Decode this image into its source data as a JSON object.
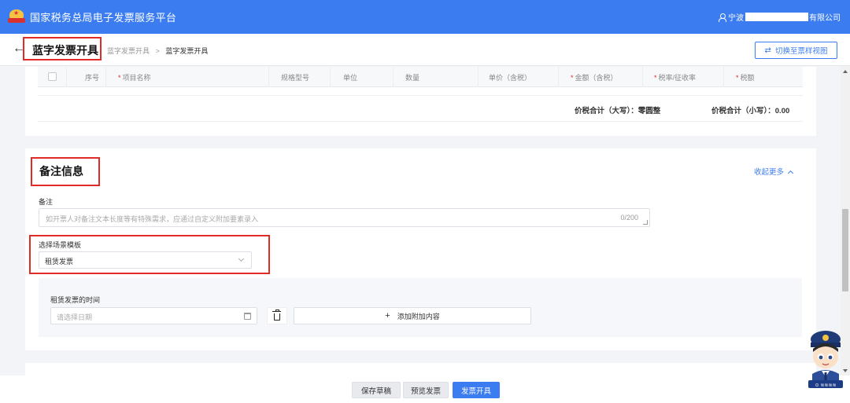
{
  "header": {
    "app_title": "国家税务总局电子发票服务平台",
    "user_prefix": "宁波",
    "user_suffix": "有限公司"
  },
  "subheader": {
    "back_icon": "arrow-left-icon",
    "page_title": "蓝字发票开具",
    "breadcrumb": [
      "蓝字发票开具",
      "蓝字发票开具"
    ],
    "breadcrumb_sep": ">",
    "switch_label": "切换至票样视图",
    "switch_icon": "⇄"
  },
  "table": {
    "columns": [
      {
        "label": "序号",
        "required": false
      },
      {
        "label": "项目名称",
        "required": true
      },
      {
        "label": "规格型号",
        "required": false
      },
      {
        "label": "单位",
        "required": false
      },
      {
        "label": "数量",
        "required": false
      },
      {
        "label": "单价（含税）",
        "required": false
      },
      {
        "label": "金额（含税）",
        "required": true
      },
      {
        "label": "税率/征收率",
        "required": true
      },
      {
        "label": "税额",
        "required": true
      }
    ],
    "total_upper_label": "价税合计（大写）：",
    "total_upper_value": "零圆整",
    "total_lower_label": "价税合计（小写）：",
    "total_lower_value": "0.00"
  },
  "remarks": {
    "section_title": "备注信息",
    "collapse_label": "收起更多",
    "remark_label": "备注",
    "remark_placeholder": "如开票人对备注文本长度等有特殊需求，应通过自定义附加要素录入",
    "remark_counter": "0/200",
    "scene_label": "选择场景模板",
    "scene_value": "租赁发票",
    "lease_time_label": "租赁发票的时间",
    "date_placeholder": "请选择日期",
    "add_label": "添加附加内容"
  },
  "actions": {
    "save_draft": "保存草稿",
    "preview": "预览发票",
    "issue": "发票开具"
  },
  "colors": {
    "primary": "#3b7cf0",
    "highlight_box": "#e02b27",
    "required_mark": "#e02b27"
  }
}
